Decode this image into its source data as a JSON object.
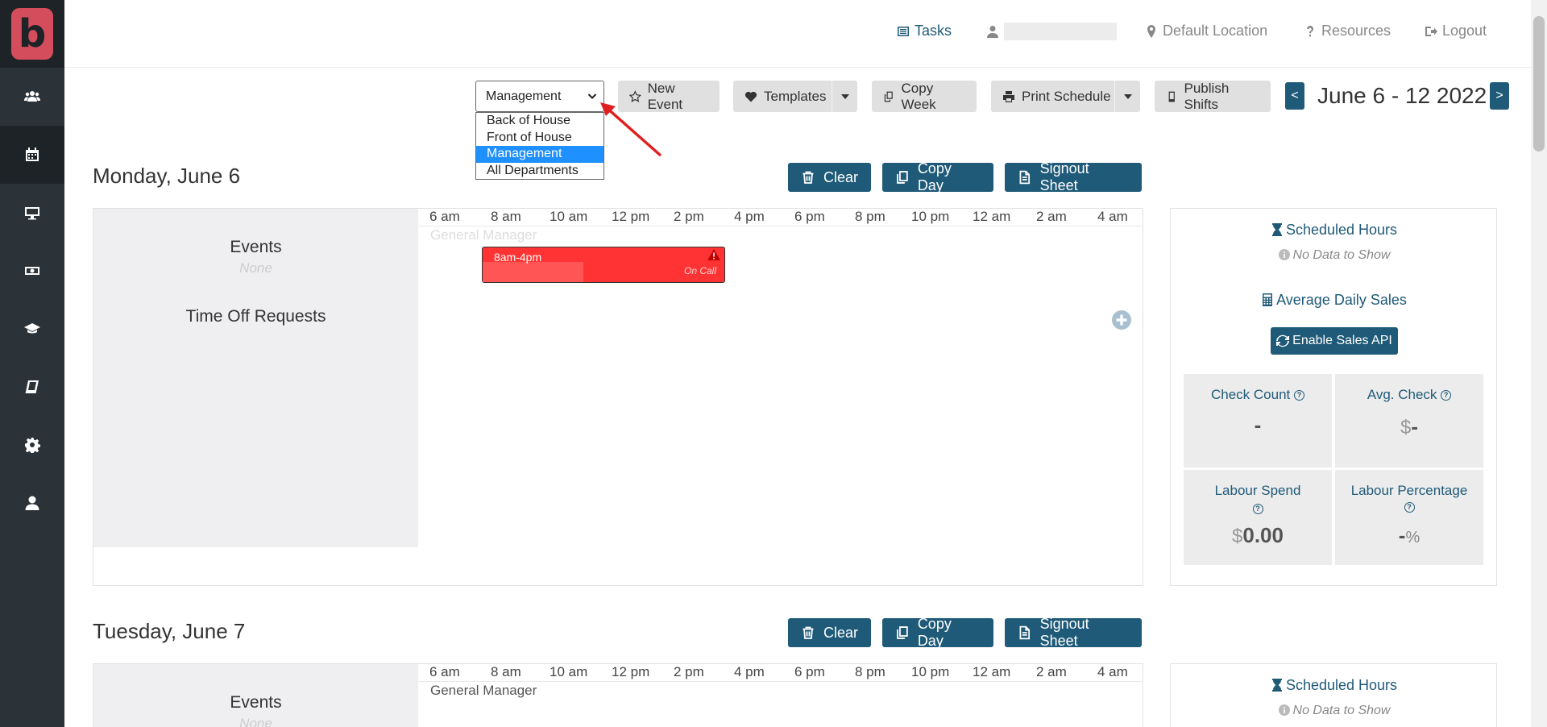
{
  "topnav": {
    "tasks": "Tasks",
    "location": "Default Location",
    "resources": "Resources",
    "logout": "Logout"
  },
  "toolbar": {
    "department_selected": "Management",
    "department_options": [
      "Back of House",
      "Front of House",
      "Management",
      "All Departments"
    ],
    "new_event": "New Event",
    "templates": "Templates",
    "copy_week": "Copy Week",
    "print_schedule": "Print Schedule",
    "publish_shifts": "Publish Shifts",
    "prev": "<",
    "next": ">",
    "week_range": "June 6 - 12 2022"
  },
  "ticks": [
    "6 am",
    "8 am",
    "10 am",
    "12 pm",
    "2 pm",
    "4 pm",
    "6 pm",
    "8 pm",
    "10 pm",
    "12 am",
    "2 am",
    "4 am"
  ],
  "days": [
    {
      "title": "Monday, June 6",
      "clear": "Clear",
      "copy_day": "Copy Day",
      "signout": "Signout Sheet",
      "events_label": "Events",
      "events_value": "None",
      "timeoff_label": "Time Off Requests",
      "role": "General Manager",
      "shift_time": "8am-4pm",
      "shift_status": "On Call"
    },
    {
      "title": "Tuesday, June 7",
      "clear": "Clear",
      "copy_day": "Copy Day",
      "signout": "Signout Sheet",
      "events_label": "Events",
      "events_value": "None",
      "role": "General Manager"
    }
  ],
  "stats": {
    "scheduled_hours": "Scheduled Hours",
    "no_data": "No Data to Show",
    "avg_daily_sales": "Average Daily Sales",
    "enable_api": "Enable Sales API",
    "check_count_label": "Check Count",
    "check_count_value": "-",
    "avg_check_label": "Avg. Check",
    "avg_check_currency": "$",
    "avg_check_value": "-",
    "labour_spend_label": "Labour Spend",
    "labour_spend_currency": "$",
    "labour_spend_value": "0.00",
    "labour_pct_label": "Labour Percentage",
    "labour_pct_value": "-",
    "labour_pct_unit": "%"
  },
  "colors": {
    "primary": "#1f5a78",
    "sidebar": "#2b3238",
    "shift": "#ff3333",
    "logo": "#d44d5c"
  }
}
